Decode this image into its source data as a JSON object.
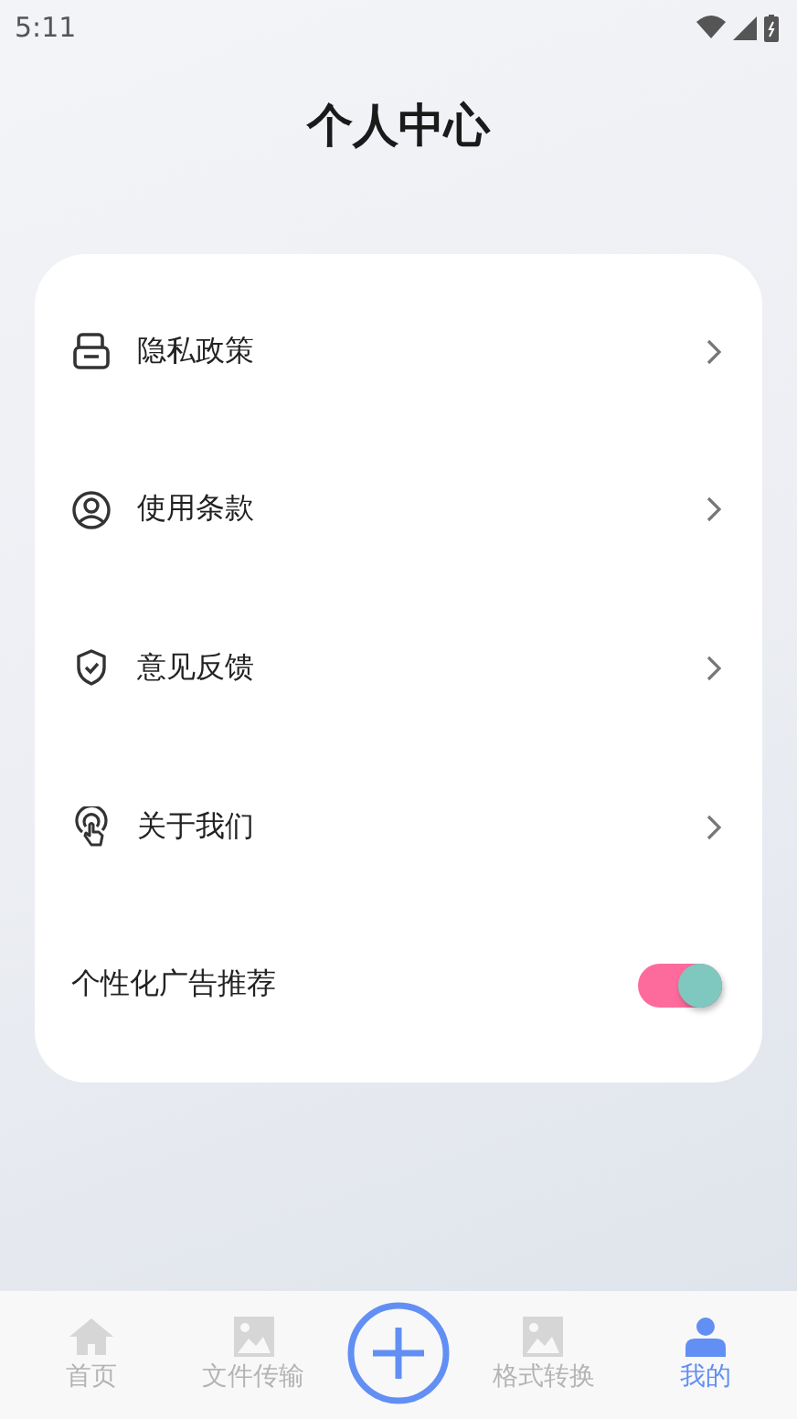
{
  "status_bar": {
    "time": "5:11"
  },
  "title": "个人中心",
  "menu": [
    {
      "label": "隐私政策",
      "kind": "link"
    },
    {
      "label": "使用条款",
      "kind": "link"
    },
    {
      "label": "意见反馈",
      "kind": "link"
    },
    {
      "label": "关于我们",
      "kind": "link"
    },
    {
      "label": "个性化广告推荐",
      "kind": "toggle",
      "on": true
    }
  ],
  "nav": [
    {
      "label": "首页",
      "kind": "home",
      "selected": false
    },
    {
      "label": "文件传输",
      "kind": "image",
      "selected": false
    },
    {
      "kind": "add"
    },
    {
      "label": "格式转换",
      "kind": "image",
      "selected": false
    },
    {
      "label": "我的",
      "kind": "person",
      "selected": true
    }
  ]
}
